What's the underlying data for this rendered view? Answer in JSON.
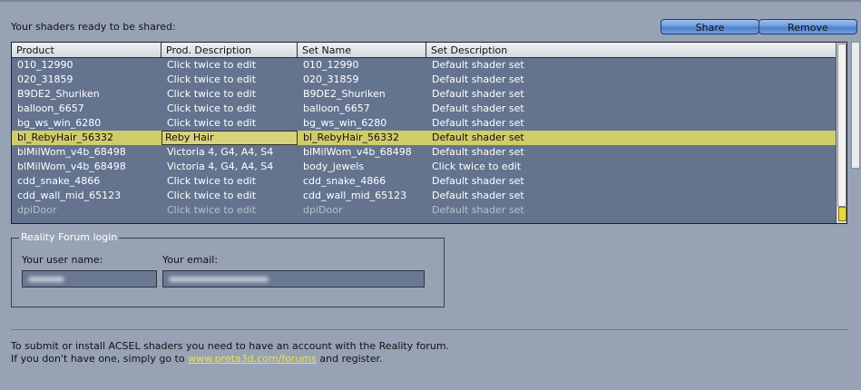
{
  "heading": "Your shaders ready to be shared:",
  "buttons": {
    "share": "Share",
    "remove": "Remove"
  },
  "table": {
    "columns": [
      "Product",
      "Prod. Description",
      "Set Name",
      "Set Description"
    ],
    "rows": [
      [
        "010_12990",
        "Click twice to edit",
        "010_12990",
        "Default shader set"
      ],
      [
        "020_31859",
        "Click twice to edit",
        "020_31859",
        "Default shader set"
      ],
      [
        "B9DE2_Shuriken",
        "Click twice to edit",
        "B9DE2_Shuriken",
        "Default shader set"
      ],
      [
        "balloon_6657",
        "Click twice to edit",
        "balloon_6657",
        "Default shader set"
      ],
      [
        "bg_ws_win_6280",
        "Click twice to edit",
        "bg_ws_win_6280",
        "Default shader set"
      ],
      [
        "bl_RebyHair_56332",
        "Reby Hair",
        "bl_RebyHair_56332",
        "Default shader set"
      ],
      [
        "blMilWom_v4b_68498",
        "Victoria 4, G4, A4, S4",
        "blMilWom_v4b_68498",
        "Default shader set"
      ],
      [
        "blMilWom_v4b_68498",
        "Victoria 4, G4, A4, S4",
        "body_jewels",
        "Click twice to edit"
      ],
      [
        "cdd_snake_4866",
        "Click twice to edit",
        "cdd_snake_4866",
        "Default shader set"
      ],
      [
        "cdd_wall_mid_65123",
        "Click twice to edit",
        "cdd_wall_mid_65123",
        "Default shader set"
      ],
      [
        "dpiDoor",
        "Click twice to edit",
        "dpiDoor",
        "Default shader set"
      ]
    ],
    "selected_row": 5
  },
  "forum": {
    "legend": "Reality Forum login",
    "username_label": "Your user name:",
    "email_label": "Your email:",
    "username_value": "",
    "email_value": ""
  },
  "info": {
    "line1": "To submit or install ACSEL shaders you need to have an account with the Reality forum.",
    "line2_prefix": "If you don't have one, simply go to",
    "link": "www.preta3d.com/forums",
    "line2_suffix": "and register."
  },
  "colors": {
    "background": "#98a2b5",
    "table_background": "#64748f",
    "selection": "#cfcc6a",
    "link": "#e8e44a",
    "button": "#6f9cdb"
  }
}
